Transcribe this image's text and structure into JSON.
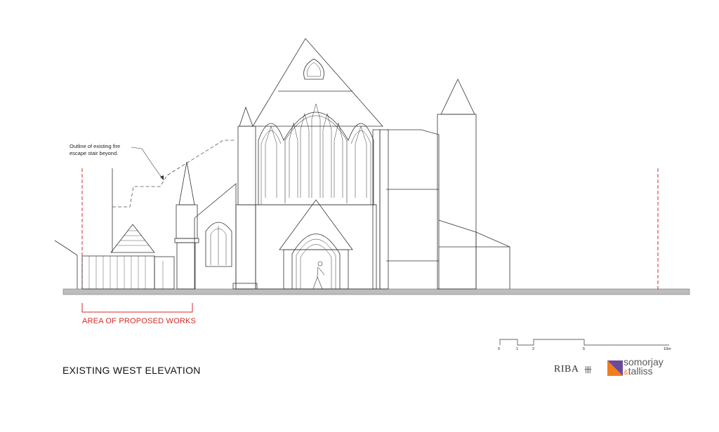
{
  "note": {
    "line1": "Outline of existing fire",
    "line2": "escape stair beyond."
  },
  "works_label": "AREA OF PROPOSED WORKS",
  "title": "EXISTING WEST ELEVATION",
  "scale": {
    "ticks": [
      "0",
      "1",
      "2",
      "5",
      "10m"
    ]
  },
  "logos": {
    "riba": "RIBA",
    "riba_crest": "卌",
    "brand_line1": "somorjay",
    "brand_amp": "&",
    "brand_line2": "talliss"
  },
  "colors": {
    "line": "#333333",
    "proposed": "#d62828",
    "ground": "#bdbdbd",
    "logo_orange": "#f07d1b",
    "logo_purple": "#6c4a9a"
  }
}
